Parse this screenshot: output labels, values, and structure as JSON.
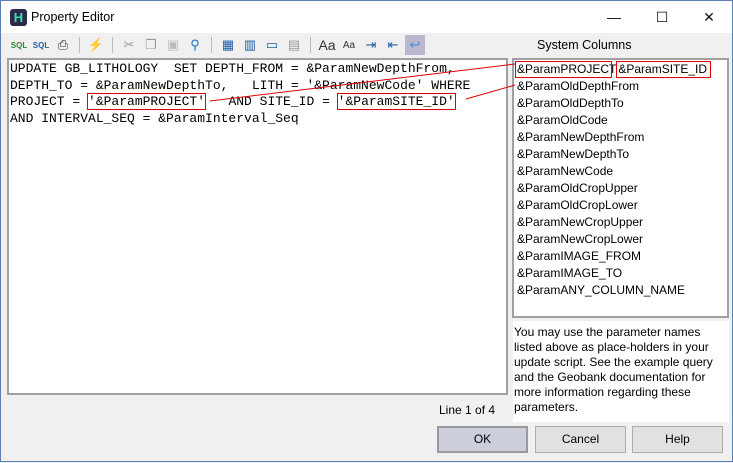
{
  "window": {
    "title": "Property Editor",
    "app_icon": "H",
    "minimize": "—",
    "maximize": "☐",
    "close": "✕"
  },
  "toolbar": [
    "sql-load-icon",
    "sql-save-icon",
    "print-icon",
    "execute-icon",
    "cut-icon",
    "copy-icon",
    "paste-icon",
    "find-icon",
    "grid-icon",
    "columns-icon",
    "comment-icon",
    "layout-icon",
    "font-larger-icon",
    "font-smaller-icon",
    "indent-icon",
    "outdent-icon",
    "word-wrap-icon"
  ],
  "editor": {
    "line1": "UPDATE GB_LITHOLOGY  SET DEPTH_FROM = &ParamNewDepthFrom,",
    "line2": "DEPTH_TO = &ParamNewDepthTo,   LITH = '&ParamNewCode' WHERE",
    "line3_a": "PROJECT = ",
    "line3_b": "'&ParamPROJECT'",
    "line3_c": "   AND SITE_ID = ",
    "line3_d": "'&ParamSITE_ID'",
    "line4": "AND INTERVAL_SEQ = &ParamInterval_Seq"
  },
  "system_columns": {
    "title": "System Columns",
    "items": [
      "&ParamPROJECT",
      "&ParamSITE_ID",
      "&ParamOldDepthFrom",
      "&ParamOldDepthTo",
      "&ParamOldCode",
      "&ParamNewDepthFrom",
      "&ParamNewDepthTo",
      "&ParamNewCode",
      "&ParamOldCropUpper",
      "&ParamOldCropLower",
      "&ParamNewCropUpper",
      "&ParamNewCropLower",
      "&ParamIMAGE_FROM",
      "&ParamIMAGE_TO",
      "&ParamANY_COLUMN_NAME"
    ]
  },
  "help_text": "You may use the parameter names listed above as place-holders in your update script. See the example query and the Geobank documentation for more information regarding these parameters.",
  "status": "Line 1 of 4",
  "buttons": {
    "ok": "OK",
    "cancel": "Cancel",
    "help": "Help"
  },
  "colors": {
    "highlight": "#e00000",
    "selected_tool": "#b9b7cf"
  }
}
